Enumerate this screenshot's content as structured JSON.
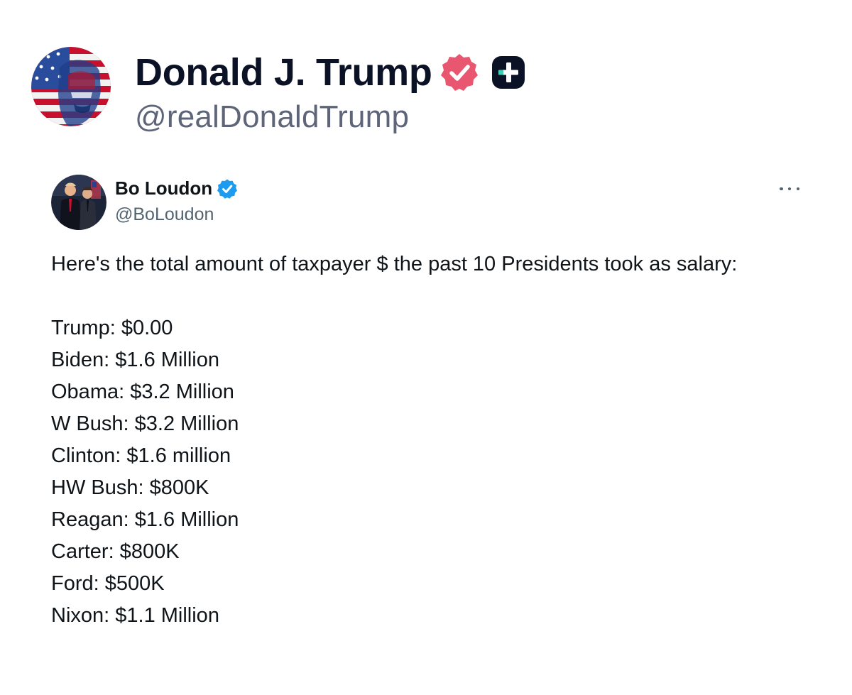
{
  "header": {
    "name": "Donald J. Trump",
    "handle": "@realDonaldTrump",
    "verified_badge_icon": "verified-badge-icon",
    "plus_badge_icon": "plus-badge-icon",
    "colors": {
      "verified_badge": "#e9566f",
      "plus_badge": "#0c1226",
      "plus_badge_accent": "#3ad1b5"
    }
  },
  "post": {
    "author_name": "Bo Loudon",
    "author_handle": "@BoLoudon",
    "verified_badge_icon": "verified-badge-icon",
    "more_icon": "more-options-icon",
    "intro": "Here's the total amount of taxpayer $ the past 10 Presidents took as salary:",
    "salaries": [
      "Trump: $0.00",
      "Biden: $1.6 Million",
      "Obama: $3.2 Million",
      "W Bush: $3.2 Million",
      "Clinton: $1.6 million",
      "HW Bush: $800K",
      "Reagan: $1.6 Million",
      "Carter: $800K",
      "Ford: $500K",
      "Nixon: $1.1 Million"
    ],
    "colors": {
      "verified_badge": "#1d9bf0",
      "text": "#0f1419",
      "secondary_text": "#536471"
    }
  }
}
